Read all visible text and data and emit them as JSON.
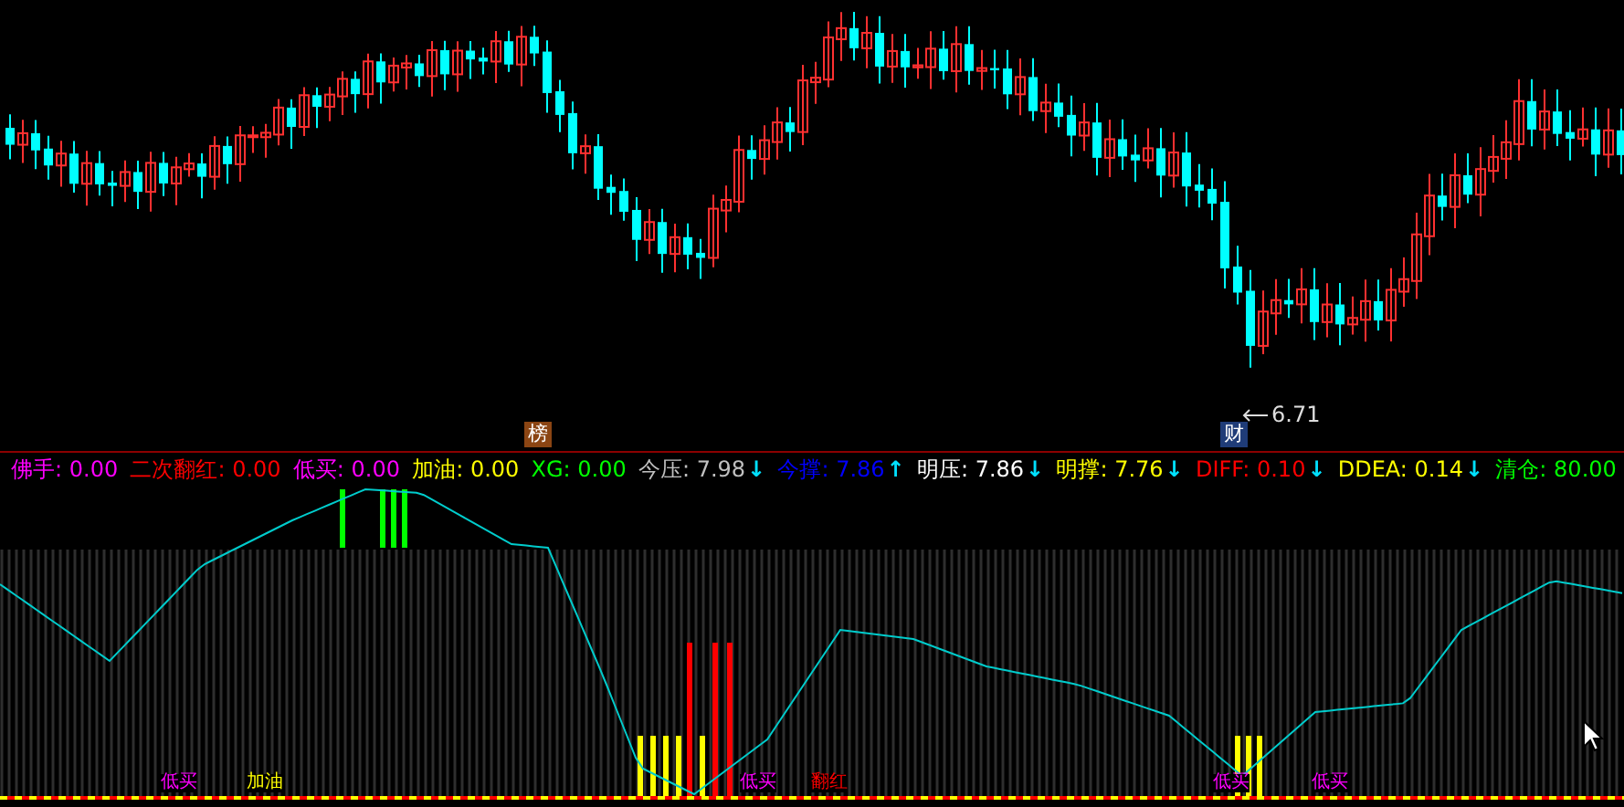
{
  "price_chart": {
    "badges": [
      "榜",
      "财"
    ],
    "low_label": "6.71"
  },
  "indicators": [
    {
      "label": "佛手:",
      "value": "0.00",
      "color": "#ff00ff"
    },
    {
      "label": "二次翻红:",
      "value": "0.00",
      "color": "#ff0000"
    },
    {
      "label": "低买:",
      "value": "0.00",
      "color": "#ff00ff"
    },
    {
      "label": "加油:",
      "value": "0.00",
      "color": "#ffff00"
    },
    {
      "label": "XG:",
      "value": "0.00",
      "color": "#00ff00"
    },
    {
      "label": "今压:",
      "value": "7.98",
      "color": "#c0c0c0",
      "arrow": "↓"
    },
    {
      "label": "今撑:",
      "value": "7.86",
      "color": "#0000ff",
      "arrow": "↑"
    },
    {
      "label": "明压:",
      "value": "7.86",
      "color": "#ffffff",
      "arrow": "↓"
    },
    {
      "label": "明撑:",
      "value": "7.76",
      "color": "#ffff00",
      "arrow": "↓"
    },
    {
      "label": "DIFF:",
      "value": "0.10",
      "color": "#ff0000",
      "arrow": "↓"
    },
    {
      "label": "DDEA:",
      "value": "0.14",
      "color": "#ffff00",
      "arrow": "↓"
    },
    {
      "label": "清仓:",
      "value": "80.00",
      "color": "#00ff00"
    }
  ],
  "markers": [
    {
      "text": "低买",
      "color": "#ff00ff"
    },
    {
      "text": "加油",
      "color": "#ffff00"
    },
    {
      "text": "低买",
      "color": "#ff00ff"
    },
    {
      "text": "翻红",
      "color": "#ff0000"
    },
    {
      "text": "低买",
      "color": "#ff00ff"
    },
    {
      "text": "低买",
      "color": "#ff00ff"
    }
  ]
}
